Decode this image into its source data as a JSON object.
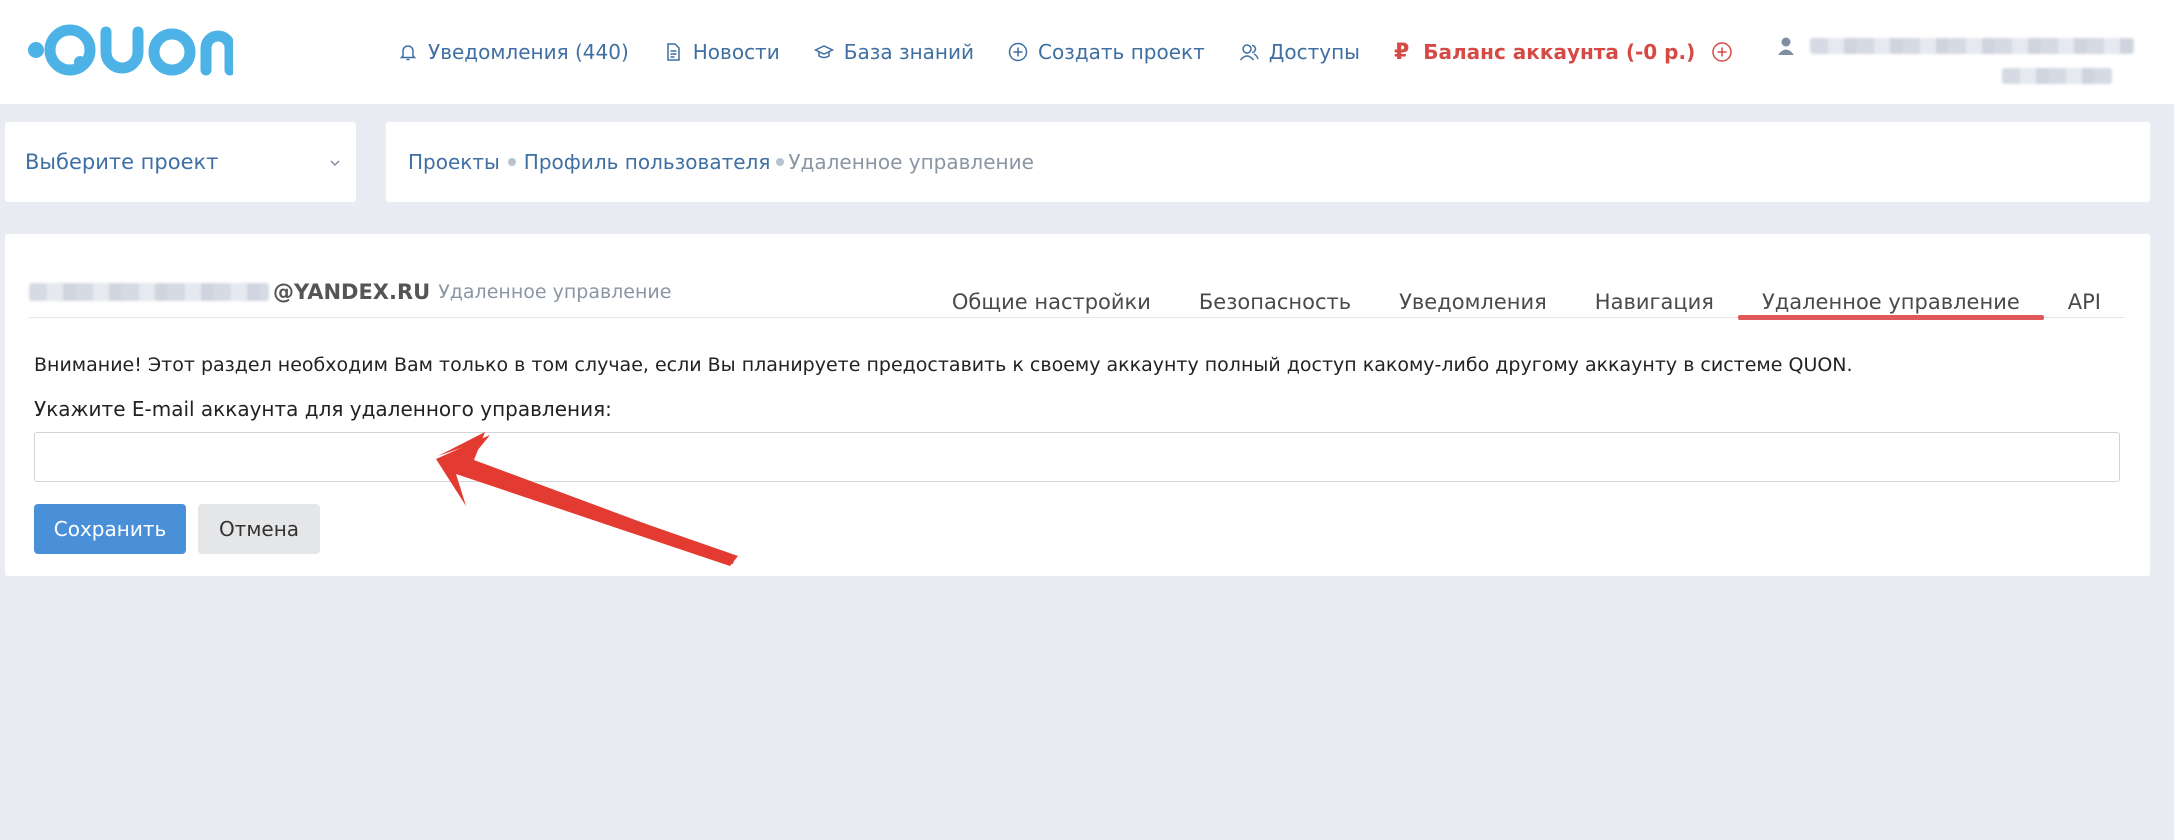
{
  "header": {
    "logo_text": "QUON",
    "nav": [
      {
        "label": "Уведомления (440)",
        "icon": "bell-icon"
      },
      {
        "label": "Новости",
        "icon": "document-icon"
      },
      {
        "label": "База знаний",
        "icon": "graduation-cap-icon"
      },
      {
        "label": "Создать проект",
        "icon": "plus-circle-icon"
      },
      {
        "label": "Доступы",
        "icon": "users-icon"
      }
    ],
    "balance": {
      "symbol": "₽",
      "label": "Баланс аккаунта (-0 р.)",
      "icon": "plus-circle-icon"
    },
    "user": {
      "icon": "user-icon"
    }
  },
  "project_select": {
    "label": "Выберите проект",
    "icon": "chevron-down-icon"
  },
  "breadcrumb": {
    "items": [
      "Проекты",
      "Профиль пользователя"
    ],
    "current": "Удаленное управление"
  },
  "card": {
    "account_domain": "@YANDEX.RU",
    "account_section": "Удаленное управление",
    "tabs": [
      {
        "label": "Общие настройки",
        "active": false
      },
      {
        "label": "Безопасность",
        "active": false
      },
      {
        "label": "Уведомления",
        "active": false
      },
      {
        "label": "Навигация",
        "active": false
      },
      {
        "label": "Удаленное управление",
        "active": true
      },
      {
        "label": "API",
        "active": false
      }
    ],
    "notice": "Внимание! Этот раздел необходим Вам только в том случае, если Вы планируете предоставить к своему аккаунту полный доступ какому-либо другому аккаунту в системе QUON.",
    "field_label": "Укажите E-mail аккаунта для удаленного управления:",
    "field_value": "",
    "save_label": "Сохранить",
    "cancel_label": "Отмена"
  },
  "colors": {
    "accent": "#4a90d9",
    "link": "#3f6fa3",
    "danger": "#d64a46",
    "active_tab": "#e0585a",
    "logo": "#4db3e6",
    "annotation_arrow": "#e33b32"
  }
}
